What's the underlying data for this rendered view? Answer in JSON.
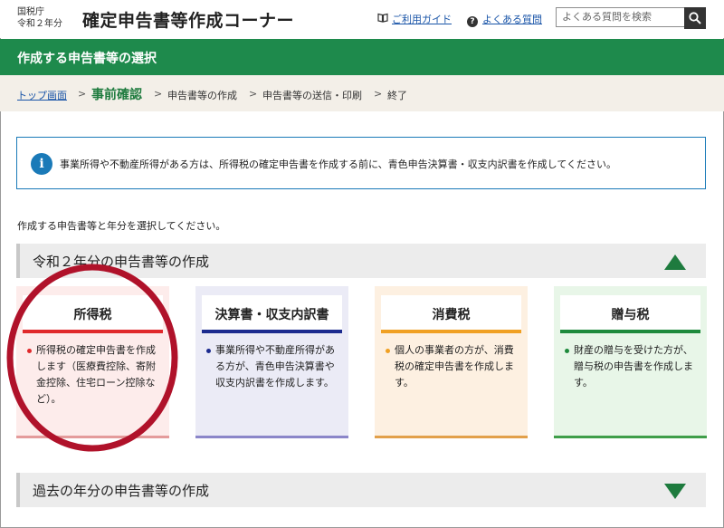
{
  "header": {
    "agency_line1": "国税庁",
    "agency_line2": "令和２年分",
    "site_title": "確定申告書等作成コーナー",
    "guide_link": "ご利用ガイド",
    "faq_link": "よくある質問",
    "search_placeholder": "よくある質問を検索"
  },
  "band": {
    "title": "作成する申告書等の選択"
  },
  "breadcrumb": {
    "items": [
      "トップ画面",
      "事前確認",
      "申告書等の作成",
      "申告書等の送信・印刷",
      "終了"
    ],
    "separator": ">"
  },
  "info": {
    "icon_glyph": "i",
    "message": "事業所得や不動産所得がある方は、所得税の確定申告書を作成する前に、青色申告決算書・収支内訳書を作成してください。"
  },
  "prompt": "作成する申告書等と年分を選択してください。",
  "section_current": {
    "title": "令和２年分の申告書等の作成"
  },
  "cards": [
    {
      "title": "所得税",
      "desc": "所得税の確定申告書を作成します（医療費控除、寄附金控除、住宅ローン控除など）。",
      "color": "#e0292b"
    },
    {
      "title": "決算書・収支内訳書",
      "desc": "事業所得や不動産所得がある方が、青色申告決算書や収支内訳書を作成します。",
      "color": "#1c2b8f"
    },
    {
      "title": "消費税",
      "desc": "個人の事業者の方が、消費税の確定申告書を作成します。",
      "color": "#f0a022"
    },
    {
      "title": "贈与税",
      "desc": "財産の贈与を受けた方が、贈与税の申告書を作成します。",
      "color": "#1e8a3c"
    }
  ],
  "section_past": {
    "title": "過去の年分の申告書等の作成"
  },
  "colors": {
    "brand_green": "#1e8a4c",
    "link": "#1a55a8",
    "annotation_circle": "#b0122a"
  }
}
